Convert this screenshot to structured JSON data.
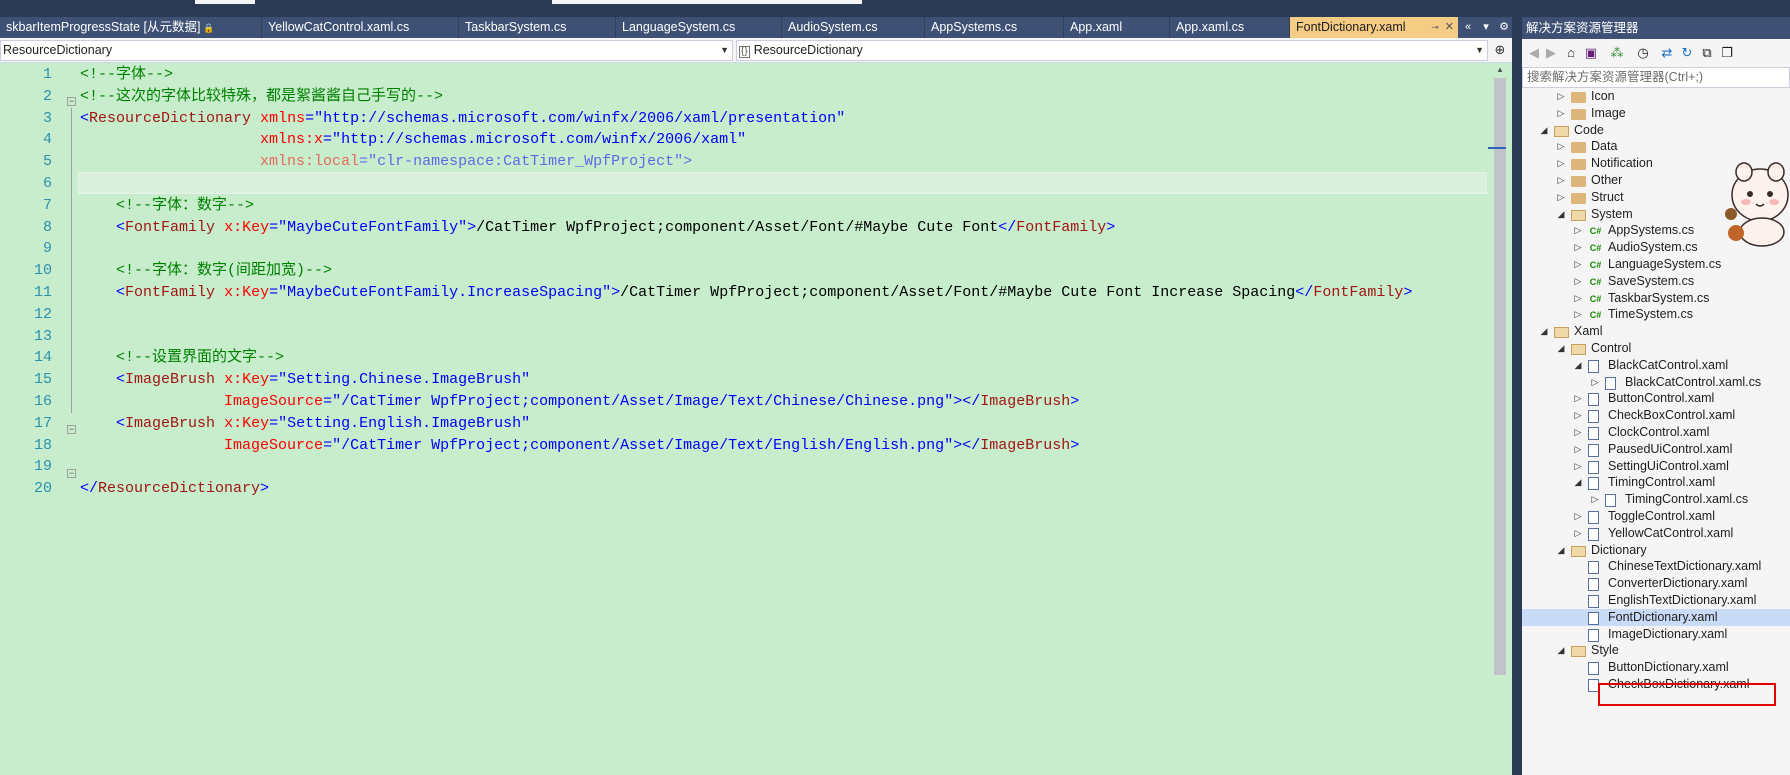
{
  "tabs": [
    {
      "label": "skbarItemProgressState [从元数据]",
      "locked": true,
      "active": false
    },
    {
      "label": "YellowCatControl.xaml.cs",
      "active": false
    },
    {
      "label": "TaskbarSystem.cs",
      "active": false
    },
    {
      "label": "LanguageSystem.cs",
      "active": false
    },
    {
      "label": "AudioSystem.cs",
      "active": false
    },
    {
      "label": "AppSystems.cs",
      "active": false
    },
    {
      "label": "App.xaml",
      "active": false
    },
    {
      "label": "App.xaml.cs",
      "active": false
    },
    {
      "label": "FontDictionary.xaml",
      "active": true
    }
  ],
  "tab_icons": {
    "pin": "pin-icon",
    "close": "close-icon",
    "overflow_left": "chevron-double-left-icon",
    "dropdown": "dropdown-icon",
    "settings": "gear-icon"
  },
  "navbar": {
    "left_combo": "ResourceDictionary",
    "right_combo": "ResourceDictionary"
  },
  "editor": {
    "line_numbers": [
      "1",
      "2",
      "3",
      "4",
      "5",
      "6",
      "7",
      "8",
      "9",
      "10",
      "11",
      "12",
      "13",
      "14",
      "15",
      "16",
      "17",
      "18",
      "19",
      "20"
    ],
    "lines": [
      [
        {
          "t": "comment",
          "v": "<!--字体-->"
        }
      ],
      [
        {
          "t": "comment",
          "v": "<!--这次的字体比较特殊，都是絮酱酱自己手写的-->"
        }
      ],
      [
        {
          "t": "punct",
          "v": "<"
        },
        {
          "t": "tag",
          "v": "ResourceDictionary"
        },
        {
          "t": "text",
          "v": " "
        },
        {
          "t": "attr",
          "v": "xmlns"
        },
        {
          "t": "punct",
          "v": "=\""
        },
        {
          "t": "val",
          "v": "http://schemas.microsoft.com/winfx/2006/xaml/presentation"
        },
        {
          "t": "punct",
          "v": "\""
        }
      ],
      [
        {
          "t": "text",
          "v": "                    "
        },
        {
          "t": "attr",
          "v": "xmlns:x"
        },
        {
          "t": "punct",
          "v": "=\""
        },
        {
          "t": "val",
          "v": "http://schemas.microsoft.com/winfx/2006/xaml"
        },
        {
          "t": "punct",
          "v": "\""
        }
      ],
      [
        {
          "t": "text",
          "v": "                    "
        },
        {
          "t": "attr",
          "v": "xmlns:local",
          "dim": true
        },
        {
          "t": "punct",
          "v": "=\"",
          "dim": true
        },
        {
          "t": "val",
          "v": "clr-namespace:CatTimer_WpfProject",
          "dim": true
        },
        {
          "t": "punct",
          "v": "\">",
          "dim": true
        }
      ],
      [],
      [
        {
          "t": "text",
          "v": "    "
        },
        {
          "t": "comment",
          "v": "<!--字体：数字-->"
        }
      ],
      [
        {
          "t": "text",
          "v": "    "
        },
        {
          "t": "punct",
          "v": "<"
        },
        {
          "t": "tag",
          "v": "FontFamily"
        },
        {
          "t": "text",
          "v": " "
        },
        {
          "t": "attr",
          "v": "x:Key"
        },
        {
          "t": "punct",
          "v": "=\""
        },
        {
          "t": "val",
          "v": "MaybeCuteFontFamily"
        },
        {
          "t": "punct",
          "v": "\">"
        },
        {
          "t": "text",
          "v": "/CatTimer WpfProject;component/Asset/Font/#Maybe Cute Font"
        },
        {
          "t": "punct",
          "v": "</"
        },
        {
          "t": "tag",
          "v": "FontFamily"
        },
        {
          "t": "punct",
          "v": ">"
        }
      ],
      [],
      [
        {
          "t": "text",
          "v": "    "
        },
        {
          "t": "comment",
          "v": "<!--字体：数字(间距加宽)-->"
        }
      ],
      [
        {
          "t": "text",
          "v": "    "
        },
        {
          "t": "punct",
          "v": "<"
        },
        {
          "t": "tag",
          "v": "FontFamily"
        },
        {
          "t": "text",
          "v": " "
        },
        {
          "t": "attr",
          "v": "x:Key"
        },
        {
          "t": "punct",
          "v": "=\""
        },
        {
          "t": "val",
          "v": "MaybeCuteFontFamily.IncreaseSpacing"
        },
        {
          "t": "punct",
          "v": "\">"
        },
        {
          "t": "text",
          "v": "/CatTimer WpfProject;component/Asset/Font/#Maybe Cute Font Increase Spacing"
        },
        {
          "t": "punct",
          "v": "</"
        },
        {
          "t": "tag",
          "v": "FontFamily"
        },
        {
          "t": "punct",
          "v": ">"
        }
      ],
      [],
      [],
      [
        {
          "t": "text",
          "v": "    "
        },
        {
          "t": "comment",
          "v": "<!--设置界面的文字-->"
        }
      ],
      [
        {
          "t": "text",
          "v": "    "
        },
        {
          "t": "punct",
          "v": "<"
        },
        {
          "t": "tag",
          "v": "ImageBrush"
        },
        {
          "t": "text",
          "v": " "
        },
        {
          "t": "attr",
          "v": "x:Key"
        },
        {
          "t": "punct",
          "v": "=\""
        },
        {
          "t": "val",
          "v": "Setting.Chinese.ImageBrush"
        },
        {
          "t": "punct",
          "v": "\""
        }
      ],
      [
        {
          "t": "text",
          "v": "                "
        },
        {
          "t": "attr",
          "v": "ImageSource"
        },
        {
          "t": "punct",
          "v": "=\""
        },
        {
          "t": "val",
          "v": "/CatTimer WpfProject;component/Asset/Image/Text/Chinese/Chinese.png"
        },
        {
          "t": "punct",
          "v": "\"></"
        },
        {
          "t": "tag",
          "v": "ImageBrush"
        },
        {
          "t": "punct",
          "v": ">"
        }
      ],
      [
        {
          "t": "text",
          "v": "    "
        },
        {
          "t": "punct",
          "v": "<"
        },
        {
          "t": "tag",
          "v": "ImageBrush"
        },
        {
          "t": "text",
          "v": " "
        },
        {
          "t": "attr",
          "v": "x:Key"
        },
        {
          "t": "punct",
          "v": "=\""
        },
        {
          "t": "val",
          "v": "Setting.English.ImageBrush"
        },
        {
          "t": "punct",
          "v": "\""
        }
      ],
      [
        {
          "t": "text",
          "v": "                "
        },
        {
          "t": "attr",
          "v": "ImageSource"
        },
        {
          "t": "punct",
          "v": "=\""
        },
        {
          "t": "val",
          "v": "/CatTimer WpfProject;component/Asset/Image/Text/English/English.png"
        },
        {
          "t": "punct",
          "v": "\"></"
        },
        {
          "t": "tag",
          "v": "ImageBrush"
        },
        {
          "t": "punct",
          "v": ">"
        }
      ],
      [],
      [
        {
          "t": "punct",
          "v": "</"
        },
        {
          "t": "tag",
          "v": "ResourceDictionary"
        },
        {
          "t": "punct",
          "v": ">"
        }
      ]
    ]
  },
  "solution_explorer": {
    "title": "解决方案资源管理器",
    "search_placeholder": "搜索解决方案资源管理器(Ctrl+;)",
    "items": [
      {
        "label": "Icon",
        "level": 2,
        "icon": "folder",
        "exp": "collapsed"
      },
      {
        "label": "Image",
        "level": 2,
        "icon": "folder",
        "exp": "collapsed"
      },
      {
        "label": "Code",
        "level": 1,
        "icon": "folder-open",
        "exp": "expanded"
      },
      {
        "label": "Data",
        "level": 2,
        "icon": "folder",
        "exp": "collapsed"
      },
      {
        "label": "Notification",
        "level": 2,
        "icon": "folder",
        "exp": "collapsed"
      },
      {
        "label": "Other",
        "level": 2,
        "icon": "folder",
        "exp": "collapsed"
      },
      {
        "label": "Struct",
        "level": 2,
        "icon": "folder",
        "exp": "collapsed"
      },
      {
        "label": "System",
        "level": 2,
        "icon": "folder-open",
        "exp": "expanded"
      },
      {
        "label": "AppSystems.cs",
        "level": 3,
        "icon": "cs",
        "exp": "collapsed"
      },
      {
        "label": "AudioSystem.cs",
        "level": 3,
        "icon": "cs",
        "exp": "collapsed"
      },
      {
        "label": "LanguageSystem.cs",
        "level": 3,
        "icon": "cs",
        "exp": "collapsed"
      },
      {
        "label": "SaveSystem.cs",
        "level": 3,
        "icon": "cs",
        "exp": "collapsed"
      },
      {
        "label": "TaskbarSystem.cs",
        "level": 3,
        "icon": "cs",
        "exp": "collapsed"
      },
      {
        "label": "TimeSystem.cs",
        "level": 3,
        "icon": "cs",
        "exp": "collapsed"
      },
      {
        "label": "Xaml",
        "level": 1,
        "icon": "folder-open",
        "exp": "expanded"
      },
      {
        "label": "Control",
        "level": 2,
        "icon": "folder-open",
        "exp": "expanded"
      },
      {
        "label": "BlackCatControl.xaml",
        "level": 3,
        "icon": "xaml",
        "exp": "expanded"
      },
      {
        "label": "BlackCatControl.xaml.cs",
        "level": 4,
        "icon": "xaml",
        "exp": "collapsed"
      },
      {
        "label": "ButtonControl.xaml",
        "level": 3,
        "icon": "xaml",
        "exp": "collapsed"
      },
      {
        "label": "CheckBoxControl.xaml",
        "level": 3,
        "icon": "xaml",
        "exp": "collapsed"
      },
      {
        "label": "ClockControl.xaml",
        "level": 3,
        "icon": "xaml",
        "exp": "collapsed"
      },
      {
        "label": "PausedUiControl.xaml",
        "level": 3,
        "icon": "xaml",
        "exp": "collapsed"
      },
      {
        "label": "SettingUiControl.xaml",
        "level": 3,
        "icon": "xaml",
        "exp": "collapsed"
      },
      {
        "label": "TimingControl.xaml",
        "level": 3,
        "icon": "xaml",
        "exp": "expanded"
      },
      {
        "label": "TimingControl.xaml.cs",
        "level": 4,
        "icon": "xaml",
        "exp": "collapsed"
      },
      {
        "label": "ToggleControl.xaml",
        "level": 3,
        "icon": "xaml",
        "exp": "collapsed"
      },
      {
        "label": "YellowCatControl.xaml",
        "level": 3,
        "icon": "xaml",
        "exp": "collapsed"
      },
      {
        "label": "Dictionary",
        "level": 2,
        "icon": "folder-open",
        "exp": "expanded"
      },
      {
        "label": "ChineseTextDictionary.xaml",
        "level": 3,
        "icon": "xaml",
        "exp": "none"
      },
      {
        "label": "ConverterDictionary.xaml",
        "level": 3,
        "icon": "xaml",
        "exp": "none"
      },
      {
        "label": "EnglishTextDictionary.xaml",
        "level": 3,
        "icon": "xaml",
        "exp": "none"
      },
      {
        "label": "FontDictionary.xaml",
        "level": 3,
        "icon": "xaml",
        "exp": "none",
        "selected": true
      },
      {
        "label": "ImageDictionary.xaml",
        "level": 3,
        "icon": "xaml",
        "exp": "none"
      },
      {
        "label": "Style",
        "level": 2,
        "icon": "folder-open",
        "exp": "expanded"
      },
      {
        "label": "ButtonDictionary.xaml",
        "level": 3,
        "icon": "xaml",
        "exp": "none"
      },
      {
        "label": "CheckBoxDictionary.xaml",
        "level": 3,
        "icon": "xaml",
        "exp": "none"
      }
    ]
  },
  "colors": {
    "editor_bg": "#c7edcc",
    "line_number": "#2b91af",
    "comment": "#008000",
    "tag": "#a31515",
    "attr": "#ff0000",
    "value": "#0000ff",
    "tab_active": "#f5cc84",
    "tab_bar": "#3e5175",
    "selection_box": "#e00000"
  }
}
